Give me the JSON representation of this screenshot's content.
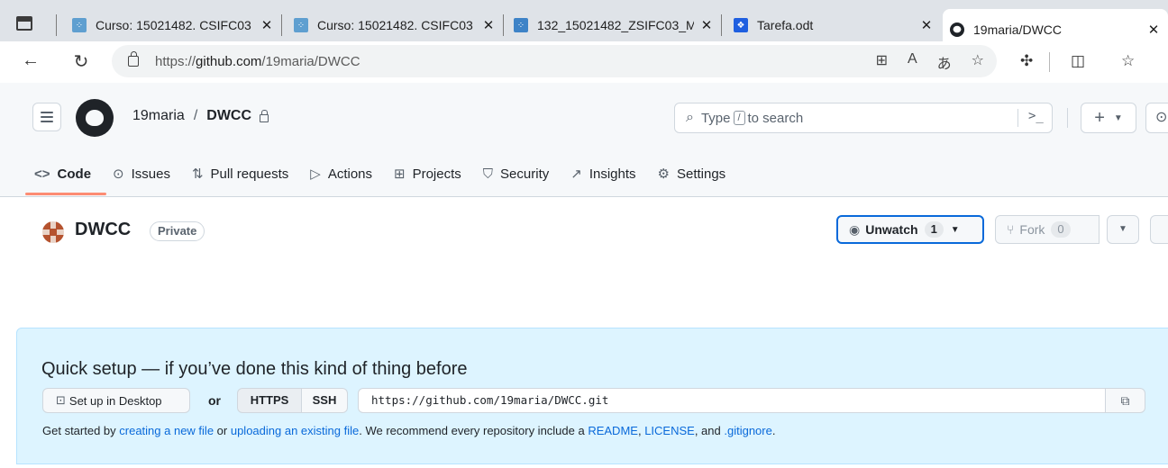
{
  "browser": {
    "tabs": [
      {
        "title": "Curso: 15021482. CSIFC03",
        "close": "✕"
      },
      {
        "title": "Curso: 15021482. CSIFC03",
        "close": "✕"
      },
      {
        "title": "132_15021482_ZSIFC03_M",
        "close": "✕"
      },
      {
        "title": "Tarefa.odt",
        "close": "✕"
      },
      {
        "title": "19maria/DWCC",
        "close": "✕"
      }
    ],
    "url_prefix": "https://",
    "url_host": "github.com",
    "url_path": "/19maria/DWCC"
  },
  "header": {
    "owner": "19maria",
    "separator": "/",
    "repo": "DWCC",
    "search_prefix": "Type",
    "search_slash": "/",
    "search_suffix": "to search",
    "command_glyph": ">_"
  },
  "repo_nav": [
    {
      "icon": "<>",
      "label": "Code"
    },
    {
      "icon": "⊙",
      "label": "Issues"
    },
    {
      "icon": "⇅",
      "label": "Pull requests"
    },
    {
      "icon": "▷",
      "label": "Actions"
    },
    {
      "icon": "⊞",
      "label": "Projects"
    },
    {
      "icon": "⛉",
      "label": "Security"
    },
    {
      "icon": "↗",
      "label": "Insights"
    },
    {
      "icon": "⚙",
      "label": "Settings"
    }
  ],
  "repo_title": {
    "name": "DWCC",
    "visibility": "Private",
    "unwatch_label": "Unwatch",
    "watch_count": "1",
    "fork_label": "Fork",
    "fork_count": "0"
  },
  "quick_setup": {
    "heading": "Quick setup — if you’ve done this kind of thing before",
    "desktop_label": "Set up in Desktop",
    "or_label": "or",
    "https_label": "HTTPS",
    "ssh_label": "SSH",
    "clone_url": "https://github.com/19maria/DWCC.git",
    "hint_1": "Get started by ",
    "link_new_file": "creating a new file",
    "hint_2": " or ",
    "link_upload": "uploading an existing file",
    "hint_3": ". We recommend every repository include a ",
    "link_readme": "README",
    "hint_4": ", ",
    "link_license": "LICENSE",
    "hint_5": ", and ",
    "link_gitignore": ".gitignore",
    "hint_6": "."
  },
  "colors": {
    "accent": "#0969da",
    "nav_underline": "#fd8c73",
    "setup_bg": "#ddf4ff"
  }
}
